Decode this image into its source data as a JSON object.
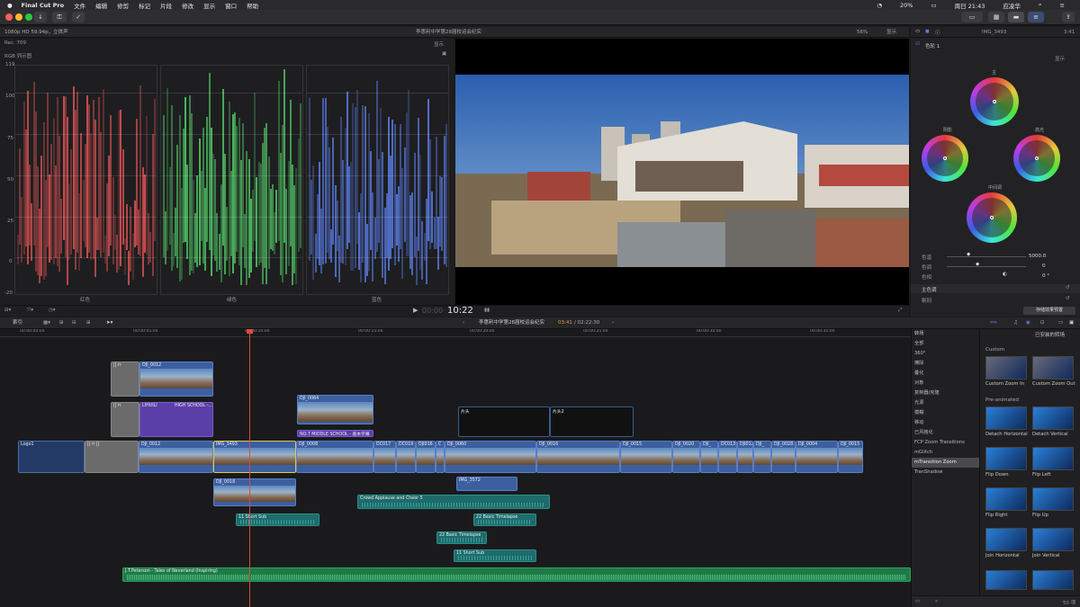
{
  "menubar": {
    "apple": "",
    "app_name": "Final Cut Pro",
    "items": [
      "文件",
      "编辑",
      "修剪",
      "标记",
      "片段",
      "修改",
      "显示",
      "窗口",
      "帮助"
    ],
    "status": {
      "battery": "20%",
      "clock": "周日 21:43",
      "user": "应凌华"
    }
  },
  "viewer": {
    "format_info": "1080p HD 59.94p，立体声",
    "title": "李惠利中学第28届校运会纪实",
    "zoom": "56%",
    "display_label": "显示",
    "timecode": "10:22",
    "timecode_dim": "00:00"
  },
  "scopes": {
    "colorspace": "Rec. 709",
    "display_label": "显示",
    "scope_name": "RGB 列示图",
    "y_ticks": [
      "119",
      "100",
      "75",
      "50",
      "25",
      "0",
      "-20"
    ],
    "channels": [
      "红色",
      "绿色",
      "蓝色"
    ],
    "colors": {
      "red": "#e25555",
      "green": "#55d36a",
      "blue": "#5b7ee8"
    }
  },
  "inspector": {
    "clip_name": "IMG_3493",
    "duration": "3:41",
    "effect_name": "色轮 1",
    "display_label": "显示",
    "wheels": [
      "主",
      "阴影",
      "高光",
      "中间调"
    ],
    "params": [
      {
        "label": "色温",
        "value": "5000.0"
      },
      {
        "label": "色调",
        "value": "0"
      },
      {
        "label": "色相",
        "value": "0 °"
      }
    ],
    "section_label": "主色调",
    "section2_label": "剔别",
    "save_button": "存储效果预置"
  },
  "timeline": {
    "index_label": "索引",
    "project_title": "李惠利中学第28届校运会纪实",
    "position": "03:41",
    "duration": "/ 02:22:30",
    "ruler": [
      "00:00:00:00",
      "00:00:05:00",
      "00:00:10:00",
      "00:00:15:00",
      "00:00:20:00",
      "00:00:25:00",
      "00:00:30:00",
      "00:00:35:00"
    ],
    "clips": {
      "connected_top": "DJI_0012",
      "lihuili": "LIHUILI",
      "high_school": "HIGH SCHOOL -...",
      "dji0064": "DJI_0064",
      "no7": "NO.7 MIDDLE SCHOOL - 基本字幕",
      "kaichang1": "片头",
      "kaichang2": "片头2",
      "logo": "Logo1",
      "primary": [
        "DJI_0012",
        "IMG_3493",
        "DJI_0008",
        "DC017",
        "DC019",
        "DJI016",
        "C",
        "DJI_0060",
        "DJI_0016",
        "DJI_0015",
        "DJI_0020",
        "DJI_",
        "DC013",
        "DJI012",
        "DJI_",
        "DJI_0028",
        "DJI_0004",
        "DJI_0015"
      ],
      "dji0018": "DJI_0018",
      "img3572": "IMG_3572",
      "crowd": "Crowd Applause and Cheer 5",
      "short1": "11 Short Sub",
      "basic22": "22 Basic Timelapse",
      "basic22b": "22 Basic Timelapse",
      "short2": "11 Short Sub",
      "music": "J.T.Peterson - Tales of Neverland (Inspiring)"
    }
  },
  "browser": {
    "title": "转场",
    "installed": "已安装的转场",
    "categories": [
      "全部",
      "360°",
      "擦除",
      "叠化",
      "对象",
      "复制器/克隆",
      "光源",
      "模糊",
      "移动",
      "已风格化",
      "FCP Zoom Transitions",
      "mGlitch",
      "mTransition Zoom",
      "TranShadow"
    ],
    "selected_category": "mTransition Zoom",
    "section_custom": "Custom",
    "section_pre": "Pre-animated",
    "items": [
      "Custom Zoom In",
      "Custom Zoom Out",
      "Detach Horizontal",
      "Detach Vertical",
      "Flip Down",
      "Flip Left",
      "Flip Right",
      "Flip Up",
      "Join Horizontal",
      "Join Vertical"
    ],
    "count": "50 项"
  }
}
